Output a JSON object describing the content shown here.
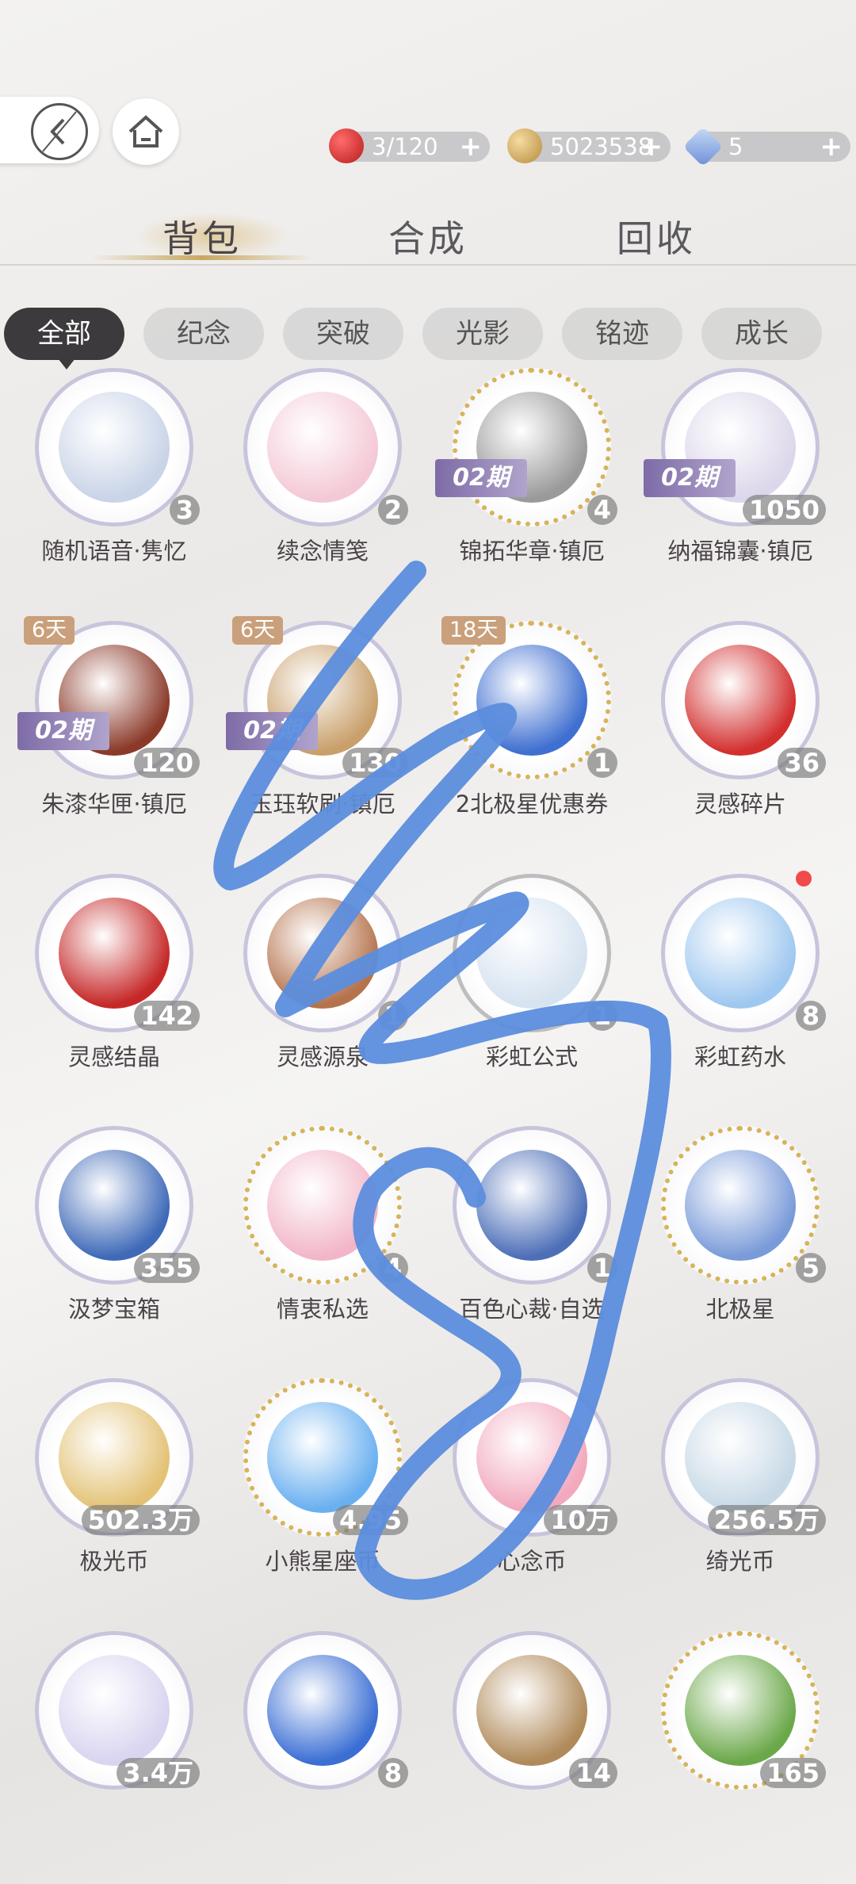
{
  "topbar": {
    "back_icon": "back-arrow-icon",
    "home_icon": "home-icon",
    "resources": [
      {
        "name": "apple-stamina",
        "value": "3/120",
        "plus": "+",
        "color": "#d32f2f"
      },
      {
        "name": "coin",
        "value": "5023538",
        "plus": "+",
        "color": "#d8b56a"
      },
      {
        "name": "diamond",
        "value": "5",
        "plus": "+",
        "color": "#8fb3e6"
      }
    ]
  },
  "main_tabs": [
    {
      "label": "背包",
      "active": true
    },
    {
      "label": "合成",
      "active": false
    },
    {
      "label": "回收",
      "active": false
    }
  ],
  "filters": [
    {
      "label": "全部",
      "active": true
    },
    {
      "label": "纪念",
      "active": false
    },
    {
      "label": "突破",
      "active": false
    },
    {
      "label": "光影",
      "active": false
    },
    {
      "label": "铭迹",
      "active": false
    },
    {
      "label": "成长",
      "active": false
    }
  ],
  "items": [
    {
      "label": "随机语音·隽忆",
      "count": "3",
      "badge": "",
      "ticket": "",
      "frame": "purple"
    },
    {
      "label": "续念情笺",
      "count": "2",
      "badge": "",
      "ticket": "",
      "frame": "purple"
    },
    {
      "label": "锦拓华章·镇厄",
      "count": "4",
      "badge": "",
      "ticket": "02期",
      "frame": "gold"
    },
    {
      "label": "纳福锦囊·镇厄",
      "count": "1050",
      "badge": "",
      "ticket": "02期",
      "frame": "purple"
    },
    {
      "label": "朱漆华匣·镇厄",
      "count": "120",
      "badge": "6天",
      "ticket": "02期",
      "frame": "purple"
    },
    {
      "label": "玉珏软刷·镇厄",
      "count": "130",
      "badge": "6天",
      "ticket": "02期",
      "frame": "purple"
    },
    {
      "label": "2北极星优惠券",
      "count": "1",
      "badge": "18天",
      "ticket": "",
      "frame": "gold"
    },
    {
      "label": "灵感碎片",
      "count": "36",
      "badge": "",
      "ticket": "",
      "frame": "purple"
    },
    {
      "label": "灵感结晶",
      "count": "142",
      "badge": "",
      "ticket": "",
      "frame": "purple"
    },
    {
      "label": "灵感源泉",
      "count": "1",
      "badge": "",
      "ticket": "",
      "frame": "purple"
    },
    {
      "label": "彩虹公式",
      "count": "1",
      "badge": "",
      "ticket": "",
      "frame": "grey"
    },
    {
      "label": "彩虹药水",
      "count": "8",
      "badge": "",
      "ticket": "",
      "frame": "purple",
      "reddot": true
    },
    {
      "label": "汲梦宝箱",
      "count": "355",
      "badge": "",
      "ticket": "",
      "frame": "purple"
    },
    {
      "label": "情衷私选",
      "count": "4",
      "badge": "",
      "ticket": "",
      "frame": "gold"
    },
    {
      "label": "百色心裁·自选",
      "count": "1",
      "badge": "",
      "ticket": "",
      "frame": "purple"
    },
    {
      "label": "北极星",
      "count": "5",
      "badge": "",
      "ticket": "",
      "frame": "gold"
    },
    {
      "label": "极光币",
      "count": "502.3万",
      "badge": "",
      "ticket": "",
      "frame": "purple"
    },
    {
      "label": "小熊星座币",
      "count": "4.95",
      "badge": "",
      "ticket": "",
      "frame": "gold"
    },
    {
      "label": "心念币",
      "count": "10万",
      "badge": "",
      "ticket": "",
      "frame": "purple"
    },
    {
      "label": "绮光币",
      "count": "256.5万",
      "badge": "",
      "ticket": "",
      "frame": "purple"
    },
    {
      "label": "",
      "count": "3.4万",
      "badge": "",
      "ticket": "",
      "frame": "purple"
    },
    {
      "label": "",
      "count": "8",
      "badge": "",
      "ticket": "",
      "frame": "purple"
    },
    {
      "label": "",
      "count": "14",
      "badge": "",
      "ticket": "",
      "frame": "purple"
    },
    {
      "label": "",
      "count": "165",
      "badge": "",
      "ticket": "",
      "frame": "gold"
    }
  ],
  "art_colors": [
    "#c9d4e8",
    "#f4c9d6",
    "#9a9a9a",
    "#dcd7ea",
    "#8b3a2a",
    "#c9a06b",
    "#3f6fd0",
    "#d32f2f",
    "#c62828",
    "#b5734d",
    "#d6e3f0",
    "#9fc8f0",
    "#3f6ab8",
    "#f2b6c8",
    "#4d6fb8",
    "#7a9bd9",
    "#e3c275",
    "#6ab0f0",
    "#f2a9bd",
    "#c7d9e6",
    "#d9d4f0",
    "#3b6fd4",
    "#b08a5a",
    "#6ba84a"
  ]
}
